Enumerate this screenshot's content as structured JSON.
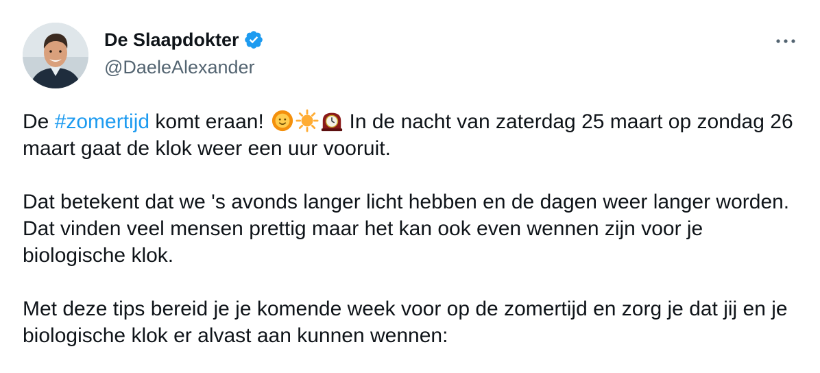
{
  "author": {
    "display_name": "De Slaapdokter",
    "handle": "@DaeleAlexander",
    "verified": true,
    "verified_color": "#1d9bf0"
  },
  "icons": {
    "more": "more-options-icon",
    "emojis": [
      "smiling-sun-icon",
      "sun-icon",
      "mantelpiece-clock-icon"
    ]
  },
  "tweet": {
    "p1_prefix": "De ",
    "p1_hashtag": "#zomertijd",
    "p1_after_hashtag": " komt eraan!",
    "p1_rest": " In de nacht van zaterdag 25 maart op zondag 26 maart gaat de klok weer een uur vooruit.",
    "p2": "Dat betekent dat we 's avonds langer licht hebben en de dagen weer langer worden. Dat vinden veel mensen prettig maar het kan ook even wennen zijn voor je biologische klok.",
    "p3": "Met deze tips bereid je je komende week voor op de zomertijd en zorg je dat jij en je biologische klok er alvast aan kunnen wennen:"
  },
  "colors": {
    "text": "#0f1419",
    "secondary": "#536471",
    "link": "#1d9bf0"
  }
}
